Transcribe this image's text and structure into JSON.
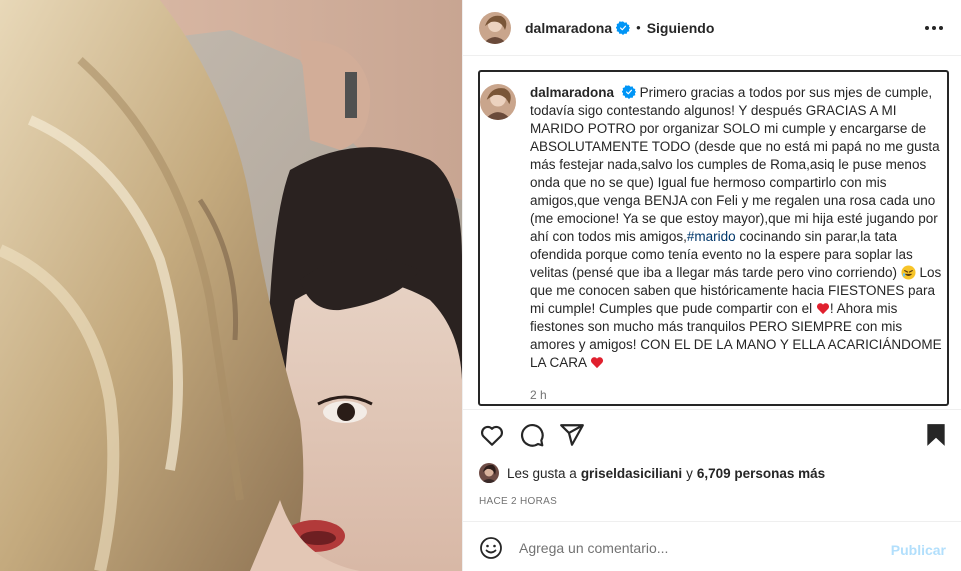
{
  "post": {
    "username": "dalmaradona",
    "follow_status": "Siguiendo",
    "separator": "•",
    "caption": {
      "username": "dalmaradona",
      "part1": "Primero gracias a todos por sus mjes de cumple, todavía sigo contestando algunos! Y después GRACIAS A MI MARIDO POTRO por organizar SOLO mi cumple y encargarse de ABSOLUTAMENTE TODO (desde que no está mi papá no me gusta más festejar nada,salvo los cumples de Roma,asiq le puse menos onda que no se que) Igual fue hermoso compartirlo con mis amigos,que venga BENJA con Feli y me regalen una rosa cada uno (me emocione! Ya se que estoy mayor),que mi hija esté jugando por ahí con todos mis amigos,",
      "hashtag": "#marido",
      "part2": " cocinando sin parar,la tata ofendida porque como tenía evento no la espere para soplar las velitas (pensé que iba a llegar más tarde pero vino corriendo) ",
      "part3": " Los que me conocen saben que históricamente hacia FIESTONES para mi cumple! Cumples que pude compartir con el ",
      "part4": "! Ahora mis fiestones son mucho más tranquilos PERO SIEMPRE con mis amores y amigos! CON EL DE LA MANO Y ELLA ACARICIÁNDOME LA CARA ",
      "emoji_laugh": "rolling-on-floor-laughing-emoji",
      "emoji_heart": "red-heart-emoji",
      "time": "2 h"
    },
    "likes": {
      "prefix": "Les gusta a",
      "liker": "griseldasiciliani",
      "connector": "y",
      "others": "6,709 personas más"
    },
    "posted_ago": "HACE 2 HORAS",
    "comment": {
      "placeholder": "Agrega un comentario...",
      "publish_label": "Publicar"
    }
  },
  "icons": {
    "verified": "verified-badge-icon",
    "more": "more-options-icon",
    "like": "heart-icon",
    "comment": "comment-icon",
    "share": "share-icon",
    "save": "bookmark-icon",
    "emoji": "emoji-icon"
  },
  "colors": {
    "text": "#262626",
    "secondary": "#737373",
    "hashtag": "#00376b",
    "verified": "#0095f6",
    "publish_disabled": "#b2dffc",
    "heart": "#ed4956"
  }
}
